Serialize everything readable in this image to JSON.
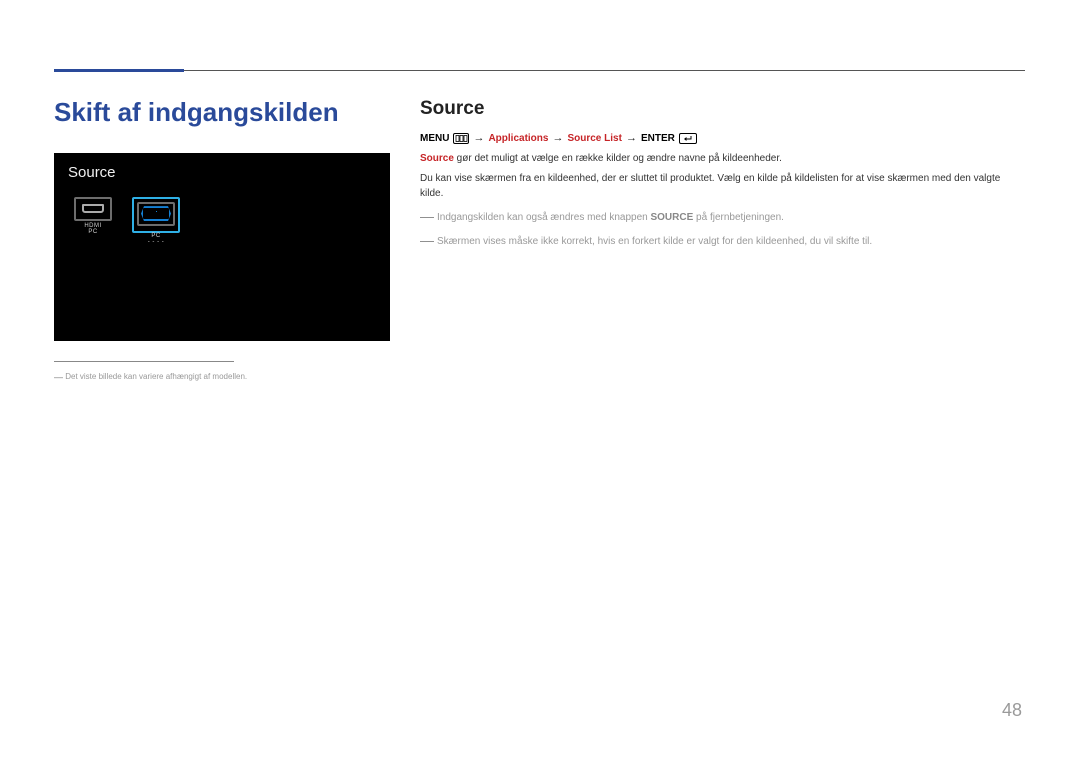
{
  "page_title": "Skift af indgangskilden",
  "section_heading": "Source",
  "source_panel": {
    "title": "Source",
    "items": [
      {
        "label": "HDMI",
        "sublabel": "PC"
      },
      {
        "label": "PC",
        "sublabel": "- - - -"
      }
    ]
  },
  "footnote": "Det viste billede kan variere afhængigt af modellen.",
  "menu_path": {
    "menu": "MENU",
    "applications": "Applications",
    "source_list": "Source List",
    "enter": "ENTER",
    "arrow": "→"
  },
  "body": {
    "p1_lead": "Source",
    "p1_rest": " gør det muligt at vælge en række kilder og ændre navne på kildeenheder.",
    "p2": "Du kan vise skærmen fra en kildeenhed, der er sluttet til produktet. Vælg en kilde på kildelisten for at vise skærmen med den valgte kilde.",
    "note1_a": "Indgangskilden kan også ændres med knappen ",
    "note1_b": "SOURCE",
    "note1_c": " på fjernbetjeningen.",
    "note2": "Skærmen vises måske ikke korrekt, hvis en forkert kilde er valgt for den kildeenhed, du vil skifte til."
  },
  "page_number": "48"
}
